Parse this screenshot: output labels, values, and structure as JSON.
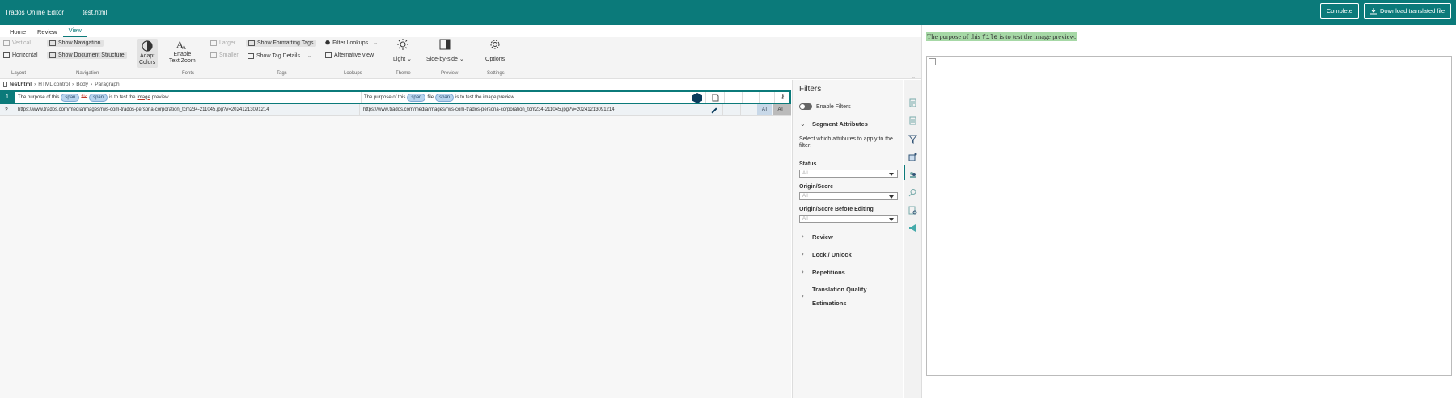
{
  "topbar": {
    "app_title": "Trados Online Editor",
    "file_name": "test.html",
    "complete_label": "Complete",
    "download_label": "Download translated file"
  },
  "tabs": [
    {
      "label": "Home",
      "active": false
    },
    {
      "label": "Review",
      "active": false
    },
    {
      "label": "View",
      "active": true
    }
  ],
  "ribbon": {
    "layout": {
      "vertical": "Vertical",
      "horizontal": "Horizontal",
      "group": "Layout"
    },
    "navigation": {
      "show_navigation": "Show Navigation",
      "show_document_structure": "Show Document Structure",
      "group": "Navigation"
    },
    "fonts": {
      "adapt": "Adapt",
      "colors": "Colors",
      "enable": "Enable",
      "text_zoom": "Text Zoom",
      "larger": "Larger",
      "smaller": "Smaller",
      "group": "Fonts"
    },
    "tags": {
      "show_formatting_tags": "Show Formatting Tags",
      "show_tag_details": "Show Tag Details",
      "group": "Tags"
    },
    "lookups": {
      "filter_lookups": "Filter Lookups",
      "alternative_view": "Alternative view",
      "group": "Lookups"
    },
    "theme": {
      "light": "Light",
      "group": "Theme"
    },
    "preview": {
      "side_by_side": "Side-by-side",
      "group": "Preview"
    },
    "settings": {
      "options": "Options",
      "group": "Settings"
    }
  },
  "breadcrumb": [
    "test.html",
    "HTML control",
    "Body",
    "Paragraph"
  ],
  "segments": [
    {
      "num": "1",
      "source_pre": "The purpose of this",
      "tag1": "span",
      "source_deleted": "file",
      "tag2": "span",
      "source_mid": "is to test the",
      "source_underlined": "image",
      "source_post": "preview.",
      "target_pre": "The purpose of this",
      "target_tag1": "span",
      "target_word": "file",
      "target_tag2": "span",
      "target_post": "is to test the image preview."
    },
    {
      "num": "2",
      "source": "https://www.trados.com/media/images/rws-com-trados-persona-corporation_tcm234-211045.jpg?v=20241213091214",
      "target": "https://www.trados.com/media/images/rws-com-trados-persona-corporation_tcm234-211045.jpg?v=20241213091214",
      "status1": "AT",
      "status2": "ATT"
    }
  ],
  "filters": {
    "title": "Filters",
    "enable_label": "Enable Filters",
    "segment_attributes": "Segment Attributes",
    "description": "Select which attributes to apply to the filter:",
    "status_label": "Status",
    "status_value": "All",
    "origin_label": "Origin/Score",
    "origin_value": "All",
    "origin_before_label": "Origin/Score Before Editing",
    "origin_before_value": "All",
    "review": "Review",
    "lock_unlock": "Lock / Unlock",
    "repetitions": "Repetitions",
    "tqe_line1": "Translation Quality",
    "tqe_line2": "Estimations"
  },
  "preview": {
    "text_pre": "The purpose of this",
    "text_code": "file",
    "text_post": "is to test the image preview."
  },
  "colors": {
    "brand": "#0b7a7a",
    "tag_bg": "#b8d4ee",
    "preview_highlight": "#a6d8a6"
  }
}
